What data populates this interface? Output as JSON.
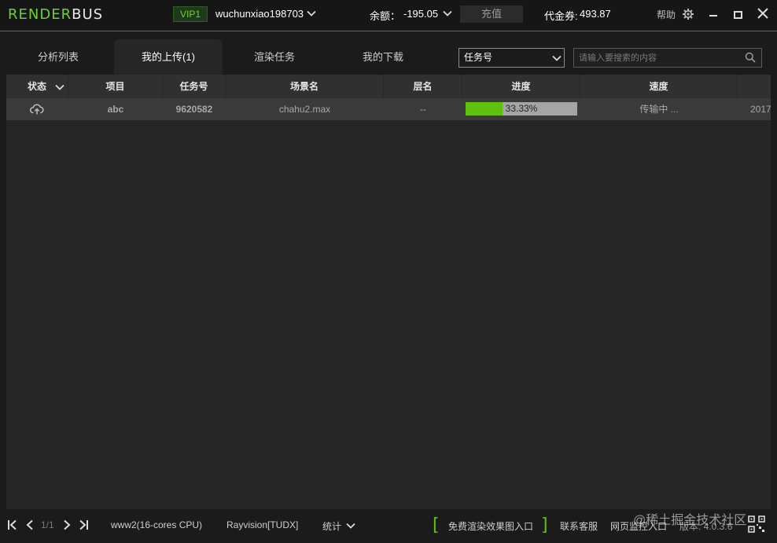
{
  "titlebar": {
    "logo_render": "RENDER",
    "logo_bus": "BUS",
    "vip": "VIP1",
    "username": "wuchunxiao198703",
    "balance_label": "余额：",
    "balance_value": "-195.05",
    "recharge_label": "充值",
    "voucher_label": "代金券:",
    "voucher_value": "493.87",
    "help_label": "帮助"
  },
  "tabs": [
    {
      "label": "分析列表",
      "active": false
    },
    {
      "label": "我的上传(1)",
      "active": true
    },
    {
      "label": "渲染任务",
      "active": false
    },
    {
      "label": "我的下载",
      "active": false
    }
  ],
  "search": {
    "filter_selected": "任务号",
    "placeholder": "请输入要搜索的内容"
  },
  "table": {
    "columns": [
      "状态",
      "项目",
      "任务号",
      "场景名",
      "层名",
      "进度",
      "速度"
    ],
    "rows": [
      {
        "project": "abc",
        "task_id": "9620582",
        "scene": "chahu2.max",
        "layer": "--",
        "progress": 0.3333,
        "progress_text": "33.33%",
        "speed": "传输中 ...",
        "date": "2017"
      }
    ]
  },
  "bottombar": {
    "page": "1/1",
    "platform": "www2(16-cores CPU)",
    "account": "Rayvision[TUDX]",
    "stats_label": "统计",
    "free_render": "免费渲染效果图入口",
    "contact": "联系客服",
    "web_monitor": "网页监控入口",
    "version": "版本: 4.0.3.6"
  },
  "watermark": "@稀土掘金技术社区",
  "colors": {
    "accent": "#5ec00f",
    "vip_green": "#6fcf3a",
    "row_bg": "#3a3a3a",
    "panel_bg": "#262626"
  }
}
